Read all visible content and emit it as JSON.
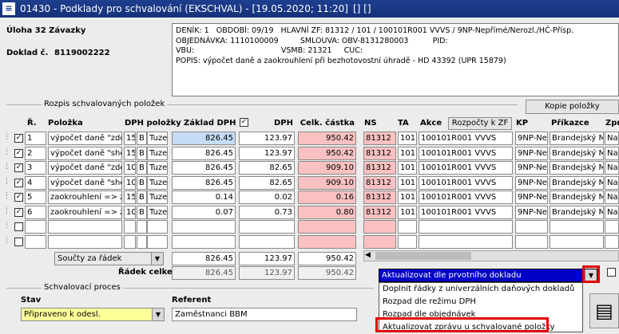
{
  "window": {
    "title": "01430 - Podklady pro schvalování (EKSCHVAL) - [19.05.2020; 11:20]",
    "title_extra": "[] []",
    "icon": "app-logo-icon"
  },
  "header": {
    "task_label": "Úloha 32 Závazky",
    "doc_label": "Doklad č.",
    "doc_value": "8119002222",
    "info_lines": [
      "DENÍK: 1   OBDOBÍ: 09/19   HLAVNÍ ZF: 81312 / 101 / 100101R001 VVVS / 9NP-Nepřímé/Nerozl./HČ-Přísp.",
      "OBJEDNÁVKA: 1110100009         SMLOUVA: OBV-8131280003          PID:",
      "VBU:                                    VSMB: 21321     CUC:",
      "POPIS: výpočet daně a zaokrouhlení při bezhotovostní úhradě - HD 43392 (UPR 15879)"
    ]
  },
  "items_section": {
    "title": "Rozpis schvalovaných položek",
    "copy_button": "Kopie položky",
    "recalc_button": "Rozpočty k ZF",
    "columns": {
      "r": "Ř.",
      "item": "Položka",
      "vat_items": "DPH položky",
      "base": "Základ DPH",
      "vat": "DPH",
      "total": "Celk. částka",
      "ns": "NS",
      "ta": "TA",
      "action": "Akce",
      "kp": "KP",
      "order": "Příkazce",
      "extra": "Zpr"
    },
    "rows": [
      {
        "n": "1",
        "item": "výpočet daně \"zdol",
        "vc": "15",
        "vt": "B",
        "vn": "Tuze",
        "base": "826.45",
        "vat": "123.97",
        "total": "950.42",
        "ns": "81312",
        "ta": "101",
        "action": "100101R001 VVVS",
        "kp": "9NP-Ne",
        "order": "Brandejský M",
        "extra": "Na"
      },
      {
        "n": "2",
        "item": "výpočet daně \"shor",
        "vc": "15",
        "vt": "B",
        "vn": "Tuze",
        "base": "826.45",
        "vat": "123.97",
        "total": "950.42",
        "ns": "81312",
        "ta": "101",
        "action": "100101R001 VVVS",
        "kp": "9NP-Ne",
        "order": "Brandejský M",
        "extra": "Na"
      },
      {
        "n": "3",
        "item": "výpočet daně \"zdol",
        "vc": "10",
        "vt": "B",
        "vn": "Tuze",
        "base": "826.45",
        "vat": "82.65",
        "total": "909.10",
        "ns": "81312",
        "ta": "101",
        "action": "100101R001 VVVS",
        "kp": "9NP-Ne",
        "order": "Brandejský M",
        "extra": "Na"
      },
      {
        "n": "4",
        "item": "výpočet daně \"shor",
        "vc": "10",
        "vt": "B",
        "vn": "Tuze",
        "base": "826.45",
        "vat": "82.65",
        "total": "909.10",
        "ns": "81312",
        "ta": "101",
        "action": "100101R001 VVVS",
        "kp": "9NP-Ne",
        "order": "Brandejský M",
        "extra": "Na"
      },
      {
        "n": "5",
        "item": "zaokrouhlení => za",
        "vc": "15",
        "vt": "B",
        "vn": "Tuze",
        "base": "0.14",
        "vat": "0.02",
        "total": "0.16",
        "ns": "81312",
        "ta": "101",
        "action": "100101R001 VVVS",
        "kp": "9NP-Ne",
        "order": "Brandejský M",
        "extra": "Na"
      },
      {
        "n": "6",
        "item": "zaokrouhlení => za",
        "vc": "10",
        "vt": "B",
        "vn": "Tuze",
        "base": "0.07",
        "vat": "0.73",
        "total": "0.80",
        "ns": "81312",
        "ta": "101",
        "action": "100101R001 VVVS",
        "kp": "9NP-Ne",
        "order": "Brandejský M",
        "extra": "Na"
      }
    ],
    "sums_select": "Součty za řádek",
    "sums_row": {
      "base": "826.45",
      "vat": "123.97",
      "total": "950.42"
    },
    "total_label": "Řádek celkem",
    "total_row": {
      "base": "826.45",
      "vat": "123.97",
      "total": "950.42"
    }
  },
  "action_dropdown": {
    "selected": "Aktualizovat dle prvotního dokladu",
    "options": [
      "Doplnit řádky z univerzálních daňových dokladů",
      "Rozpad dle režimu DPH",
      "Rozpad dle objednávek",
      "Aktualizovat zprávu u schvalované položky"
    ]
  },
  "approval": {
    "title": "Schvalovací proces",
    "state_label": "Stav",
    "state_value": "Připraveno k odesl.",
    "referent_label": "Referent",
    "referent_value": "Zaměstnanci BBM"
  },
  "colors": {
    "titlebar": "#1e3e8e",
    "highlight_red": "#e30000",
    "pink_cell": "#f9c1c1",
    "blue_cell": "#c6dcf5",
    "yellow_field": "#ffff99",
    "selected_blue": "#0000c8"
  }
}
